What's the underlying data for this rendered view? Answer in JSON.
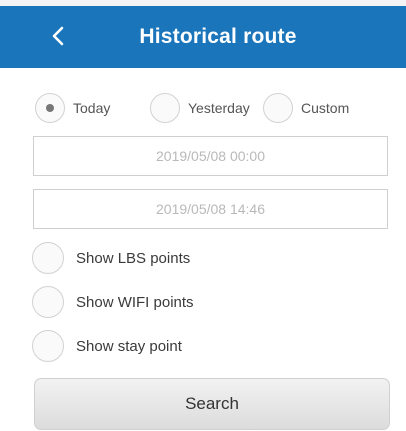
{
  "header": {
    "title": "Historical route",
    "back_icon": "chevron-left-icon",
    "background_color": "#1b75bb"
  },
  "date_range": {
    "selected": "Today",
    "options": [
      {
        "label": "Today",
        "checked": true
      },
      {
        "label": "Yesterday",
        "checked": false
      },
      {
        "label": "Custom",
        "checked": false
      }
    ],
    "start_time": "2019/05/08 00:00",
    "end_time": "2019/05/08 14:46"
  },
  "options": {
    "show_lbs": "Show LBS points",
    "show_wifi": "Show WIFI points",
    "show_stay": "Show stay point"
  },
  "actions": {
    "search_label": "Search"
  }
}
